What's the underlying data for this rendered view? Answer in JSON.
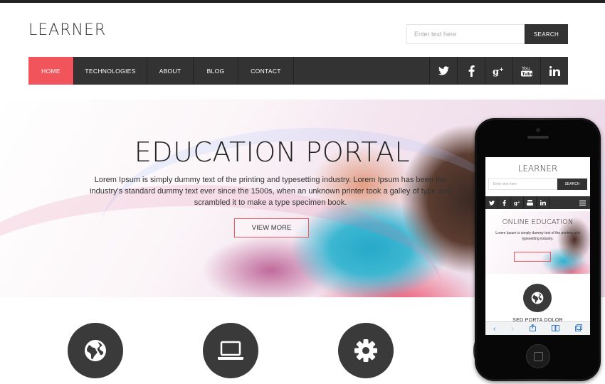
{
  "header": {
    "logo": "LEARNER",
    "search_placeholder": "Enter text here",
    "search_button": "SEARCH"
  },
  "nav": {
    "items": [
      {
        "label": "HOME",
        "active": true
      },
      {
        "label": "TECHNOLOGIES",
        "active": false
      },
      {
        "label": "ABOUT",
        "active": false
      },
      {
        "label": "BLOG",
        "active": false
      },
      {
        "label": "CONTACT",
        "active": false
      }
    ],
    "social_icons": [
      "twitter-icon",
      "facebook-icon",
      "google-plus-icon",
      "youtube-icon",
      "linkedin-icon"
    ]
  },
  "hero": {
    "title": "EDUCATION PORTAL",
    "text": "Lorem Ipsum is simply dummy text of the printing and typesetting industry. Lorem Ipsum has been the industry's standard dummy text ever since the 1500s, when an unknown printer took a galley of type and scrambled it to make a type specimen book.",
    "button": "VIEW MORE"
  },
  "features": {
    "icons": [
      "globe-icon",
      "laptop-icon",
      "gear-icon"
    ]
  },
  "mobile": {
    "logo": "LEARNER",
    "search_placeholder": "Enter text here",
    "search_button": "SEARCH",
    "hero_title": "ONLINE EDUCATION",
    "hero_text": "Lorem Ipsum is simply dummy text of the printing and typesetting industry.",
    "section_title": "SED PORTA DOLOR"
  },
  "colors": {
    "accent": "#f2545b",
    "nav_bg": "#333333",
    "icon_circle": "#3a3a3a"
  }
}
